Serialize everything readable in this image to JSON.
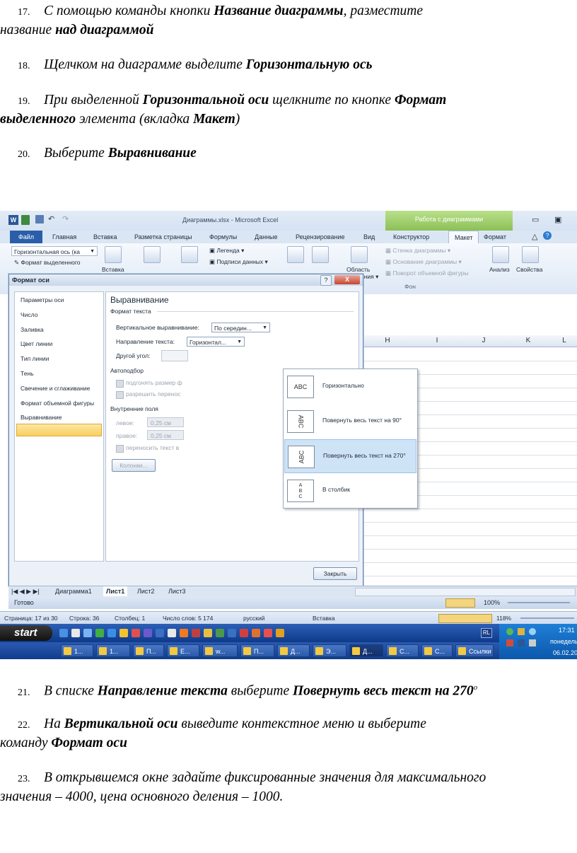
{
  "steps_top": [
    {
      "num": "17.",
      "parts": [
        [
          "i",
          "С помощью команды кнопки "
        ],
        [
          "b",
          "Название диаграммы"
        ],
        [
          "i",
          ", разместите"
        ]
      ],
      "line2": [
        [
          "i",
          "название "
        ],
        [
          "b",
          "над диаграммой"
        ]
      ]
    },
    {
      "num": "18.",
      "parts": [
        [
          "i",
          "Щелчком на диаграмме выделите "
        ],
        [
          "b",
          "Горизонтальную ось"
        ]
      ]
    },
    {
      "num": "19.",
      "parts": [
        [
          "i",
          "При выделенной "
        ],
        [
          "b",
          "Горизонтальной оси"
        ],
        [
          "i",
          " щелкните по кнопке "
        ],
        [
          "b",
          "Формат"
        ]
      ],
      "line2": [
        [
          "b",
          "выделенного"
        ],
        [
          "i",
          " элемента (вкладка "
        ],
        [
          "b",
          "Макет"
        ],
        [
          "i",
          ")"
        ]
      ]
    },
    {
      "num": "20.",
      "parts": [
        [
          "i",
          "Выберите "
        ],
        [
          "b",
          "Выравнивание"
        ]
      ]
    }
  ],
  "steps_bottom": [
    {
      "num": "21.",
      "parts": [
        [
          "i",
          "В списке "
        ],
        [
          "b",
          "Направление текста"
        ],
        [
          "i",
          " выберите "
        ],
        [
          "b",
          "Повернуть весь текст на 270"
        ],
        [
          "sup",
          "о"
        ]
      ]
    },
    {
      "num": "22.",
      "parts": [
        [
          "i",
          "На "
        ],
        [
          "b",
          "Вертикальной оси"
        ],
        [
          "i",
          " выведите контекстное меню и выберите"
        ]
      ],
      "line2": [
        [
          "i",
          "команду "
        ],
        [
          "b",
          "Формат оси"
        ]
      ]
    },
    {
      "num": "23.",
      "parts": [
        [
          "i",
          "В открывшемся окне задайте фиксированные значения для максимального"
        ]
      ],
      "line2": [
        [
          "i",
          "значения – 4000, цена основного деления – 1000."
        ]
      ]
    }
  ],
  "excel": {
    "window_title": "Диаграммы.xlsx  -  Microsoft Excel",
    "context_header": "Работа с диаграммами",
    "file_tab": "Файл",
    "tabs": [
      "Главная",
      "Вставка",
      "Разметка страницы",
      "Формулы",
      "Данные",
      "Рецензирование",
      "Вид",
      "Конструктор",
      "Макет",
      "Формат"
    ],
    "selected_tab": "Макет",
    "element_selector": "Горизонтальная ось (ка",
    "format_selection": "Формат выделенного",
    "ribbon_labels": {
      "legend": "Легенда",
      "data_labels": "Подписи данных",
      "chart_wall": "Стенка диаграммы",
      "chart_floor": "Основание диаграммы",
      "rotation": "Поворот объемной фигуры",
      "background_group": "Фон",
      "analysis": "Анализ",
      "properties": "Свойства",
      "insert": "Вставка",
      "area": "Область",
      "series": "ения"
    },
    "columns": [
      "H",
      "I",
      "J",
      "K",
      "L"
    ],
    "sheet_tabs": [
      "Диаграмма1",
      "Лист1",
      "Лист2",
      "Лист3"
    ],
    "active_sheet": "Лист1",
    "status": "Готово",
    "zoom": "100%"
  },
  "dialog": {
    "title": "Формат оси",
    "help": "?",
    "close": "X",
    "nav_items": [
      "Параметры оси",
      "Число",
      "Заливка",
      "Цвет линии",
      "Тип линии",
      "Тень",
      "Свечение и сглаживание",
      "Формат объемной фигуры",
      "Выравнивание"
    ],
    "selected_nav": "Выравнивание",
    "panel_title": "Выравнивание",
    "section_text_format": "Формат текста",
    "vertical_align_label": "Вертикальное выравнивание:",
    "vertical_align_value": "По середин...",
    "text_direction_label": "Направление текста:",
    "text_direction_value": "Горизонтал...",
    "other_angle_label": "Другой угол:",
    "section_autofit": "Автоподбор",
    "autofit_1": "подгонять размер ф",
    "autofit_2": "разрешить перенос",
    "section_margins": "Внутренние поля",
    "left_label": "левое:",
    "left_value": "0,25 см",
    "right_label": "правое:",
    "right_value": "0,25 см",
    "wrap_label": "переносить текст в",
    "columns_button": "Колонки...",
    "close_button": "Закрыть",
    "dropdown": [
      {
        "icon": "ABC",
        "label": "Горизонтально"
      },
      {
        "icon": "ABC",
        "label": "Повернуть весь текст на 90°"
      },
      {
        "icon": "ABC",
        "label": "Повернуть весь текст на 270°"
      },
      {
        "icon": "A B C",
        "label": "В столбик"
      }
    ],
    "dropdown_selected_index": 2
  },
  "word_status": {
    "page": "Страница: 17 из 30",
    "line": "Строка: 36",
    "column": "Столбец: 1",
    "words": "Число слов: 5 174",
    "language": "русский",
    "mode": "Вставка",
    "zoom": "118%"
  },
  "taskbar": {
    "start": "start",
    "buttons": [
      "1...",
      "1...",
      "П...",
      "Е...",
      "w...",
      "П...",
      "Д...",
      "Э...",
      "Д...",
      "С...",
      "С...",
      "Ссылки"
    ],
    "lang": "RL",
    "time": "17:31",
    "day": "понедель",
    "date": "06.02.20"
  }
}
